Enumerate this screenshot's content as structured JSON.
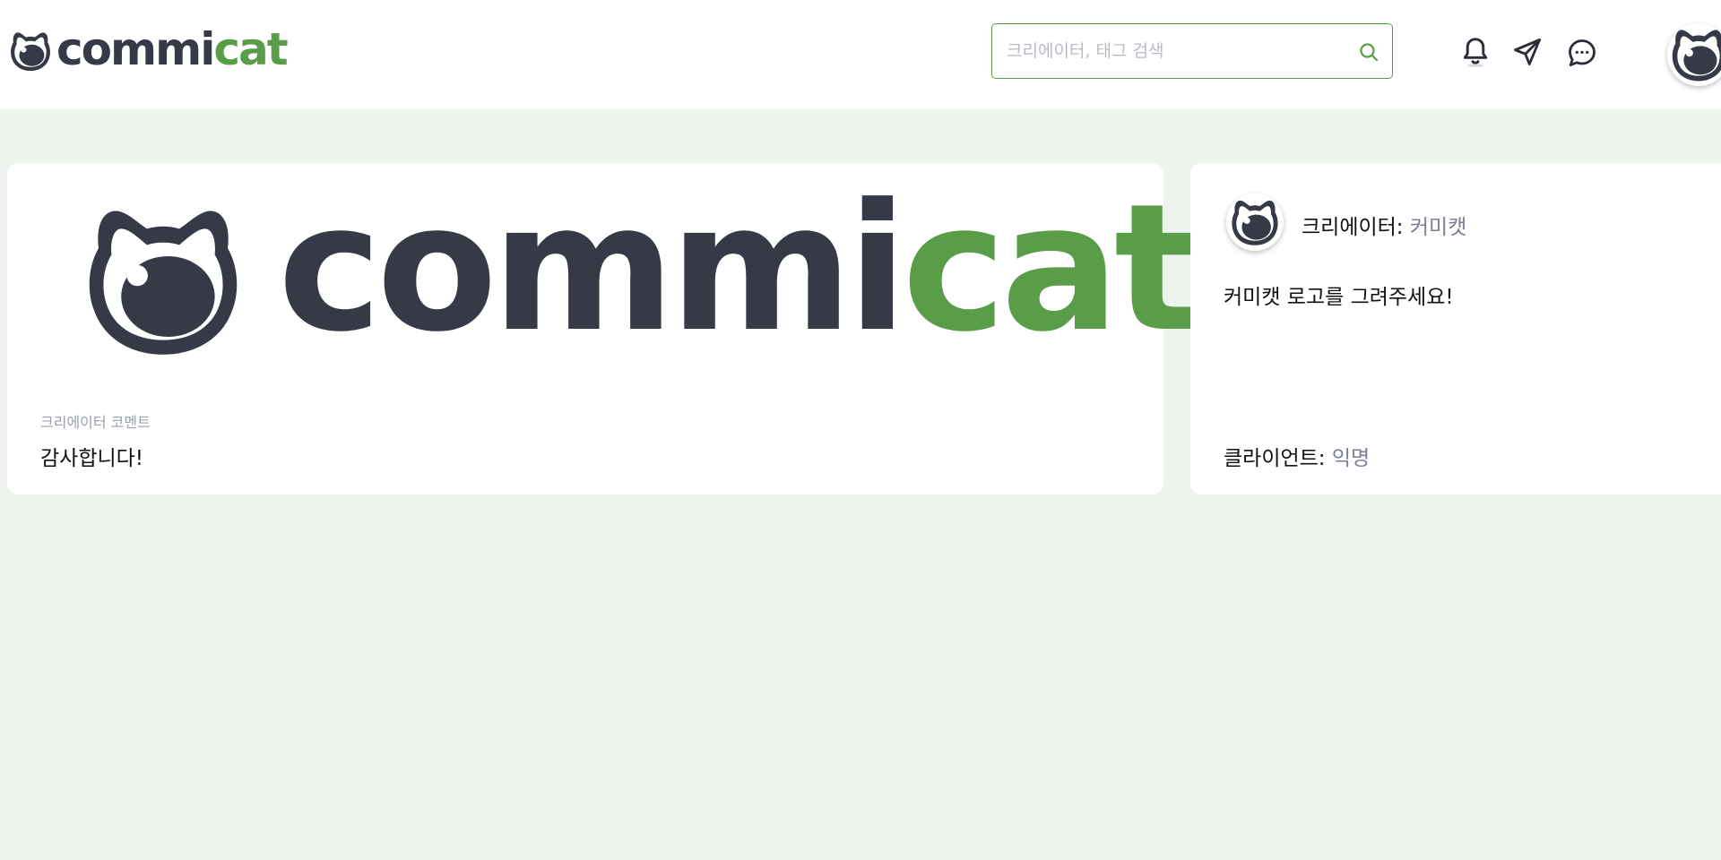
{
  "header": {
    "logo": {
      "text_dark": "commi",
      "text_green": "cat"
    },
    "search": {
      "placeholder": "크리에이터, 태그 검색",
      "value": ""
    },
    "icons": [
      "bell-icon",
      "send-icon",
      "chat-icon",
      "avatar"
    ]
  },
  "artwork": {
    "text_dark": "commi",
    "text_green": "cat"
  },
  "comment": {
    "label": "크리에이터 코멘트",
    "text": "감사합니다!"
  },
  "detail": {
    "creator_label": "크리에이터: ",
    "creator_name": "커미캣",
    "request": "커미캣 로고를 그려주세요!",
    "client_label": "클라이언트: ",
    "client_name": "익명"
  },
  "colors": {
    "brand_dark": "#363946",
    "brand_green": "#5a9d48",
    "background": "#eef3ee",
    "muted_link": "#7b7f93"
  }
}
